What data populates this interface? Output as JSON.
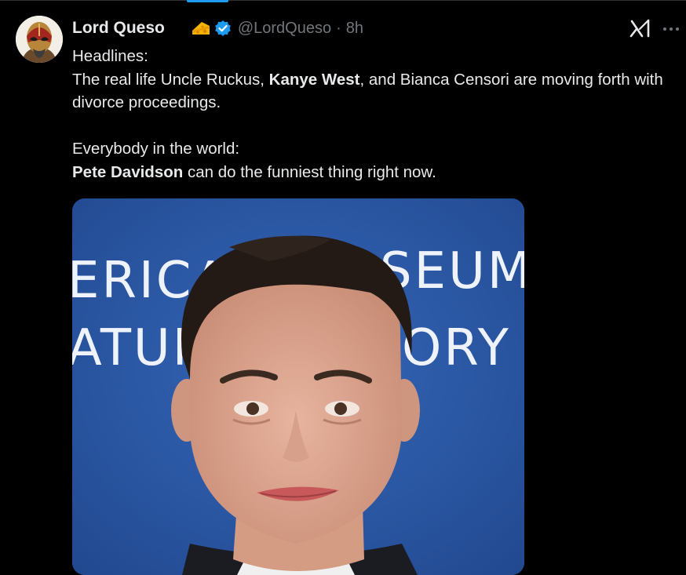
{
  "tweet": {
    "author": {
      "display_name": "Lord Queso",
      "handle": "@LordQueso",
      "badge_icon": "cheese-icon",
      "verified_icon": "verified-badge-icon"
    },
    "separator": "·",
    "time": "8h",
    "text": {
      "line1": "Headlines:",
      "line2_pre": "The real life Uncle Ruckus, ",
      "line2_bold": "Kanye West",
      "line2_post": ", and Bianca Censori are moving forth with divorce proceedings.",
      "line3": "Everybody in the world:",
      "line4_bold": "Pete Davidson",
      "line4_post": " can do the funniest thing right now."
    },
    "media": {
      "backdrop_text_top_left": "ERICA",
      "backdrop_text_top_right": "SEUM",
      "backdrop_text_bottom_left": "ATUR",
      "backdrop_text_bottom_right": "ORY"
    },
    "actions": {
      "grok_icon": "grok-icon",
      "more_icon": "more-options-icon"
    }
  },
  "colors": {
    "background": "#000000",
    "text": "#e7e9ea",
    "muted": "#71767b",
    "accent": "#1d9bf0"
  }
}
